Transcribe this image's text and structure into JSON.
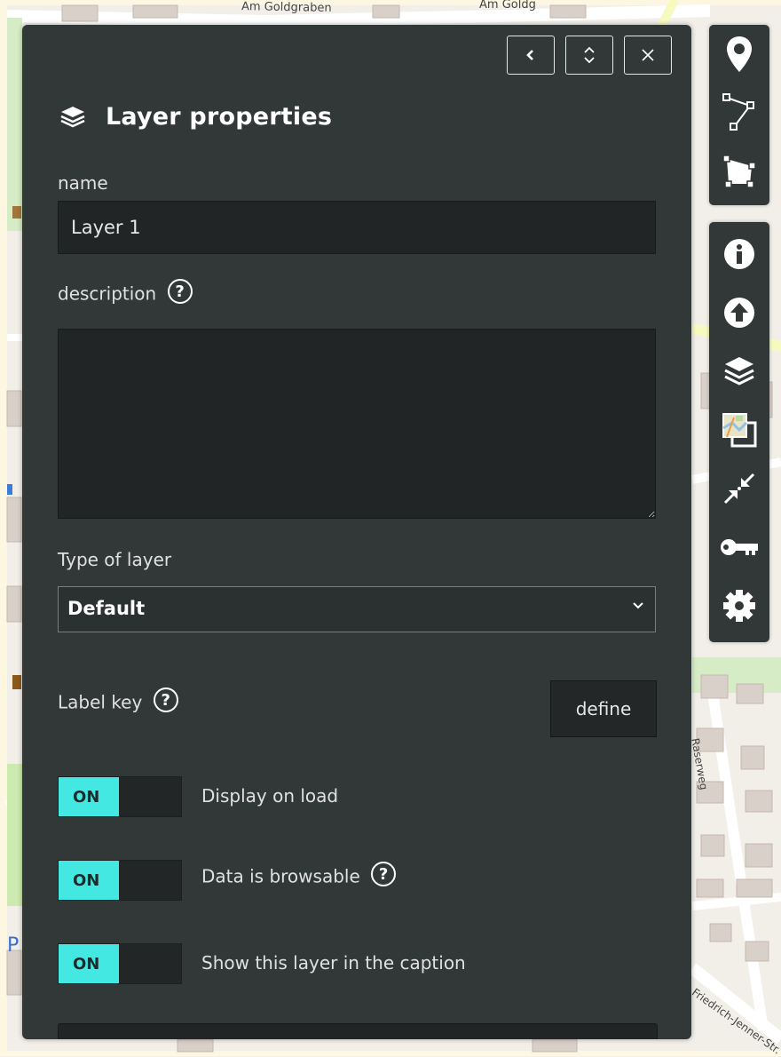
{
  "map": {
    "labels": [
      "Am Goldgraben",
      "Am Goldg",
      "Raserweg",
      "Friedrich-Jenner-Str."
    ]
  },
  "panel": {
    "title": "Layer properties",
    "title_icon": "layers-icon",
    "header_buttons": [
      {
        "name": "collapse-left-button",
        "icon": "chevron-left-icon"
      },
      {
        "name": "expand-button",
        "icon": "expand-vertical-icon"
      },
      {
        "name": "close-button",
        "icon": "close-icon"
      }
    ],
    "name_label": "name",
    "name_value": "Layer 1",
    "description_label": "description",
    "description_value": "",
    "type_label": "Type of layer",
    "type_selected": "Default",
    "label_key_label": "Label key",
    "define_label": "define",
    "toggles": [
      {
        "state": "ON",
        "label": "Display on load"
      },
      {
        "state": "ON",
        "label": "Data is browsable"
      },
      {
        "state": "ON",
        "label": "Show this layer in the caption"
      }
    ]
  },
  "toolbar": {
    "draw_tools": [
      "marker-icon",
      "polyline-icon",
      "polygon-icon"
    ],
    "main_tools": [
      "info-icon",
      "upload-icon",
      "layers-icon",
      "tilelayer-icon",
      "shrink-icon",
      "key-icon",
      "gear-icon"
    ]
  },
  "colors": {
    "panel_bg": "#323737",
    "toggle_on": "#43e8e3",
    "input_bg": "#212525"
  }
}
